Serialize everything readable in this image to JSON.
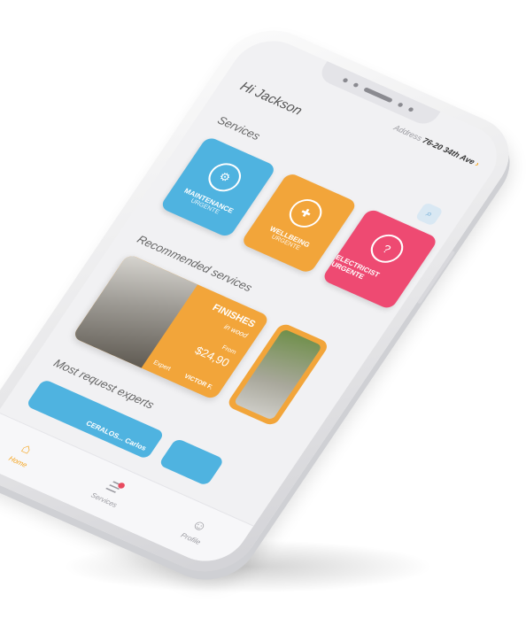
{
  "header": {
    "address_label": "Address",
    "address_value": "76-20 34th Ave",
    "greeting": "Hi Jackson"
  },
  "services": {
    "title": "Services",
    "items": [
      {
        "title": "MAINTENANCE",
        "subtitle": "URGENTE",
        "color": "#4fb3e0",
        "icon": "tools-icon"
      },
      {
        "title": "WELLBEING",
        "subtitle": "URGENTE",
        "color": "#f2a53a",
        "icon": "wellbeing-icon"
      },
      {
        "title": "ELECTRICIST URGENTE",
        "subtitle": "",
        "color": "#ee4a72",
        "icon": "electric-icon"
      }
    ]
  },
  "recommended": {
    "title": "Recommended services",
    "card": {
      "title": "FINISHES",
      "subtitle": "in wood",
      "from_label": "From",
      "price": "$24,90",
      "expert_label": "Expert",
      "expert_name": "VICTOR F."
    }
  },
  "experts": {
    "title": "Most request experts",
    "card_name": "CERALOS... Carlos"
  },
  "tabs": [
    {
      "label": "Home",
      "icon": "home-icon",
      "active": true
    },
    {
      "label": "Services",
      "icon": "services-icon",
      "active": false
    },
    {
      "label": "Profile",
      "icon": "profile-icon",
      "active": false
    }
  ],
  "colors": {
    "accent": "#f5a623",
    "blue": "#4fb3e0",
    "orange": "#f2a53a",
    "pink": "#ee4a72"
  }
}
